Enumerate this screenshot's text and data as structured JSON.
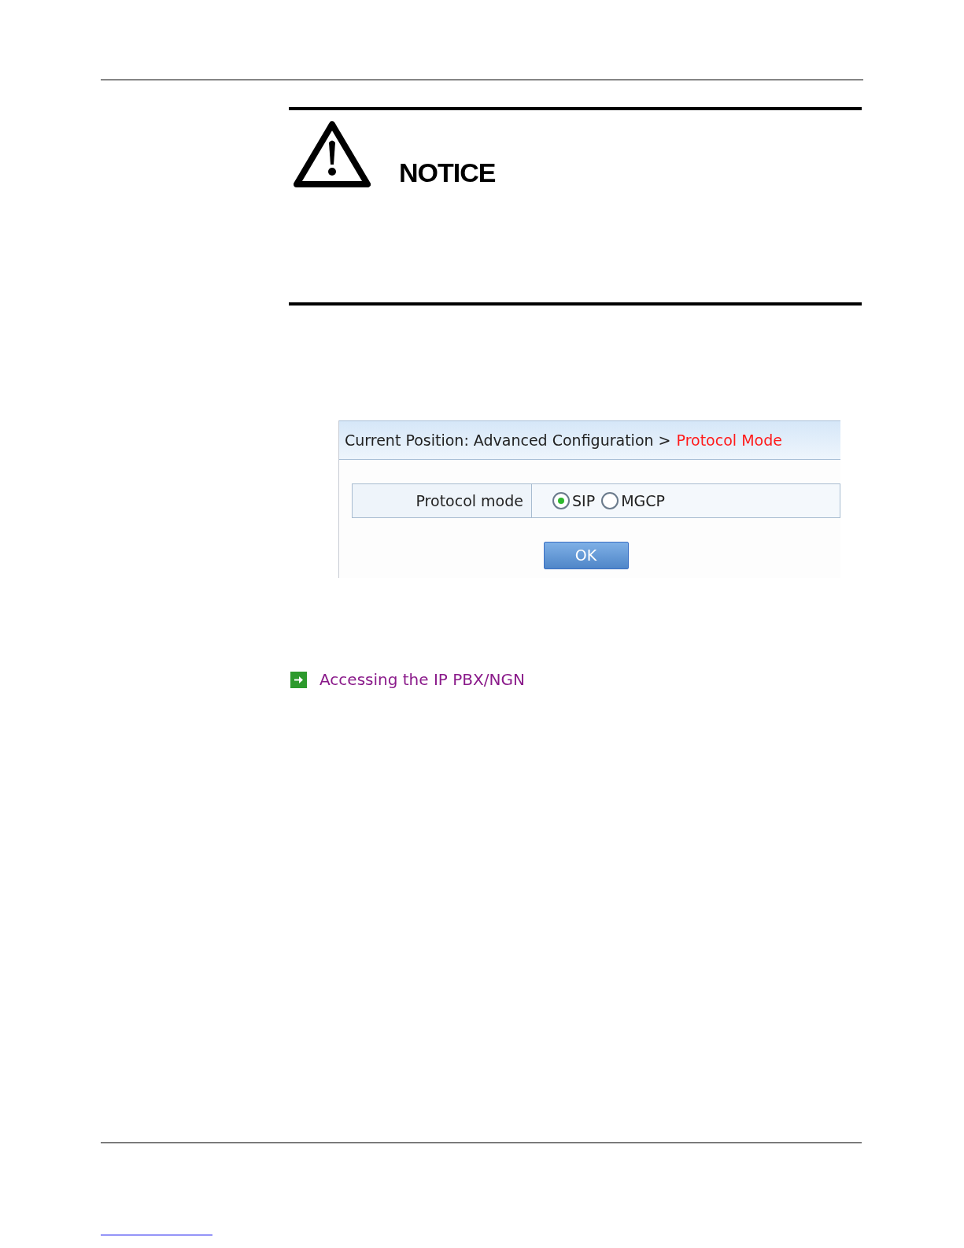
{
  "notice": {
    "title": "NOTICE"
  },
  "screenshot": {
    "breadcrumb": {
      "path": "Current Position: Advanced Configuration >",
      "current": "Protocol Mode"
    },
    "field": {
      "label": "Protocol mode",
      "options": [
        {
          "label": "SIP",
          "selected": true
        },
        {
          "label": "MGCP",
          "selected": false
        }
      ]
    },
    "button": "OK"
  },
  "link": {
    "label": "Accessing the IP PBX/NGN"
  }
}
